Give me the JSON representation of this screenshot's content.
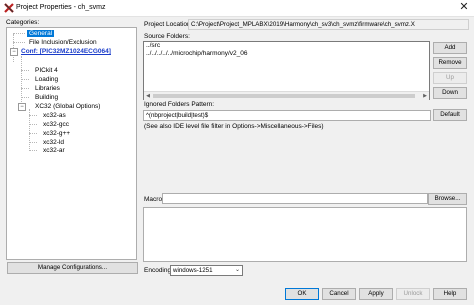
{
  "window": {
    "title": "Project Properties - ch_svmz",
    "close_glyph": "✕"
  },
  "categories": {
    "label": "Categories:",
    "items": [
      {
        "label": "General"
      },
      {
        "label": "File Inclusion/Exclusion"
      },
      {
        "label": "Conf: [PIC32MZ1024ECG064]"
      },
      {
        "label": "PICkit 4"
      },
      {
        "label": "Loading"
      },
      {
        "label": "Libraries"
      },
      {
        "label": "Building"
      },
      {
        "label": "XC32 (Global Options)"
      },
      {
        "label": "xc32-as"
      },
      {
        "label": "xc32-gcc"
      },
      {
        "label": "xc32-g++"
      },
      {
        "label": "xc32-ld"
      },
      {
        "label": "xc32-ar"
      }
    ],
    "manage_button": "Manage Configurations..."
  },
  "project_location": {
    "label": "Project Location:",
    "value": "C:\\Project\\Project_MPLABX\\2019\\Harmony\\ch_sv3\\ch_svmz\\firmware\\ch_svmz.X"
  },
  "source_folders": {
    "label": "Source Folders:",
    "rows": [
      "../src",
      "../../../../../microchip/harmony/v2_06"
    ],
    "buttons": {
      "add": "Add",
      "remove": "Remove",
      "up": "Up",
      "down": "Down"
    }
  },
  "ignored": {
    "label": "Ignored Folders Pattern:",
    "value": "^(nbproject|build|test)$",
    "default_button": "Default",
    "hint": "(See also IDE level file filter in Options->Miscellaneous->Files)"
  },
  "macro": {
    "label": "Macro:",
    "value": "",
    "browse_button": "Browse..."
  },
  "encoding": {
    "label": "Encoding:",
    "value": "windows-1251"
  },
  "footer": {
    "ok": "OK",
    "cancel": "Cancel",
    "apply": "Apply",
    "unlock": "Unlock",
    "help": "Help"
  },
  "colors": {
    "selection": "#0078d7",
    "conf_link": "#1a3cc9"
  },
  "icons": {
    "app": "mplab-app-icon",
    "close": "close-icon",
    "dropdown": "chevron-down-icon"
  }
}
